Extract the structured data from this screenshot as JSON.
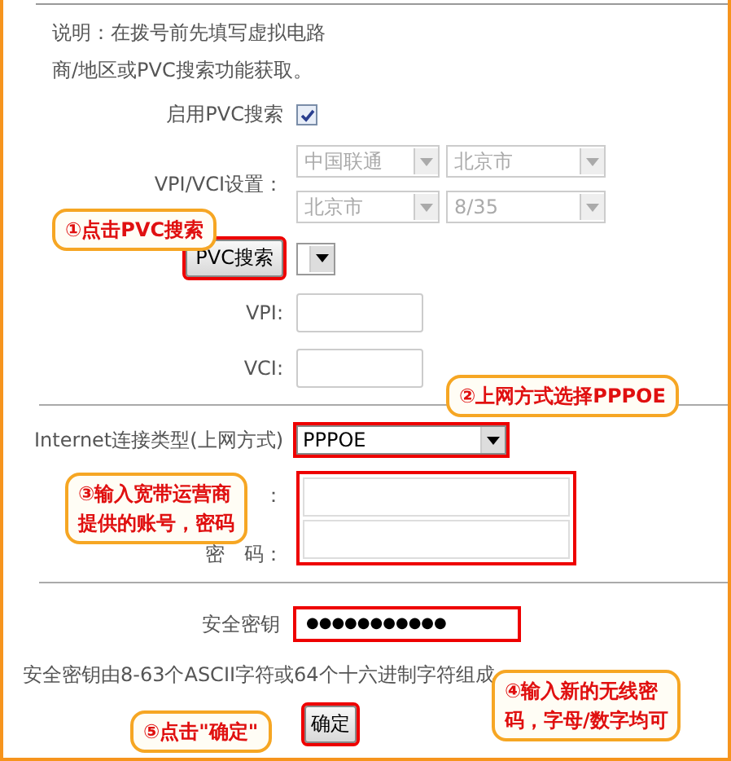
{
  "description": [
    "说明：在拨号前先填写虚拟电路",
    "商/地区或PVC搜索功能获取。"
  ],
  "pvc_search": {
    "label": "启用PVC搜索",
    "checked": true
  },
  "vpi_vci": {
    "label": "VPI/VCI设置：",
    "selects": [
      {
        "value": "中国联通",
        "disabled": true
      },
      {
        "value": "北京市",
        "disabled": true
      },
      {
        "value": "北京市",
        "disabled": true
      },
      {
        "value": "8/35",
        "disabled": true
      }
    ]
  },
  "pvc_button": {
    "label": "PVC搜索",
    "highlighted": true
  },
  "vpi": {
    "label": "VPI:"
  },
  "vci": {
    "label": "VCI:"
  },
  "connection_type": {
    "label": "Internet连接类型(上网方式)",
    "value": "PPPOE",
    "highlighted": true
  },
  "account": {
    "username_label": "：",
    "password_label": "密　码：",
    "highlighted": true
  },
  "security_key": {
    "label": "安全密钥",
    "value": "●●●●●●●●●●●",
    "highlighted": true
  },
  "key_hint": "安全密钥由8-63个ASCII字符或64个十六进制字符组成",
  "confirm_button": {
    "label": "确定",
    "highlighted": true
  },
  "callouts": [
    {
      "lines": [
        "①点击PVC搜索"
      ]
    },
    {
      "lines": [
        "②上网方式选择PPPOE"
      ]
    },
    {
      "lines": [
        "③输入宽带运营商",
        "提供的账号，密码"
      ]
    },
    {
      "lines": [
        "④输入新的无线密",
        "码，字母/数字均可"
      ]
    },
    {
      "lines": [
        "⑤点击\"确定\""
      ]
    }
  ]
}
